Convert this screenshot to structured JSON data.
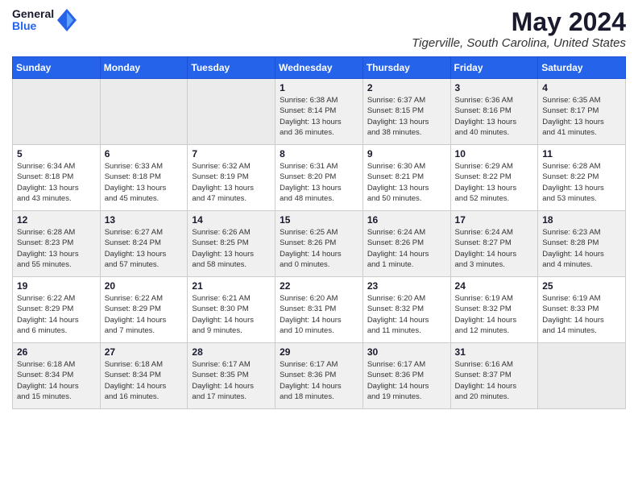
{
  "header": {
    "logo_general": "General",
    "logo_blue": "Blue",
    "month_title": "May 2024",
    "location": "Tigerville, South Carolina, United States"
  },
  "days_of_week": [
    "Sunday",
    "Monday",
    "Tuesday",
    "Wednesday",
    "Thursday",
    "Friday",
    "Saturday"
  ],
  "weeks": [
    [
      {
        "day": "",
        "info": ""
      },
      {
        "day": "",
        "info": ""
      },
      {
        "day": "",
        "info": ""
      },
      {
        "day": "1",
        "info": "Sunrise: 6:38 AM\nSunset: 8:14 PM\nDaylight: 13 hours\nand 36 minutes."
      },
      {
        "day": "2",
        "info": "Sunrise: 6:37 AM\nSunset: 8:15 PM\nDaylight: 13 hours\nand 38 minutes."
      },
      {
        "day": "3",
        "info": "Sunrise: 6:36 AM\nSunset: 8:16 PM\nDaylight: 13 hours\nand 40 minutes."
      },
      {
        "day": "4",
        "info": "Sunrise: 6:35 AM\nSunset: 8:17 PM\nDaylight: 13 hours\nand 41 minutes."
      }
    ],
    [
      {
        "day": "5",
        "info": "Sunrise: 6:34 AM\nSunset: 8:18 PM\nDaylight: 13 hours\nand 43 minutes."
      },
      {
        "day": "6",
        "info": "Sunrise: 6:33 AM\nSunset: 8:18 PM\nDaylight: 13 hours\nand 45 minutes."
      },
      {
        "day": "7",
        "info": "Sunrise: 6:32 AM\nSunset: 8:19 PM\nDaylight: 13 hours\nand 47 minutes."
      },
      {
        "day": "8",
        "info": "Sunrise: 6:31 AM\nSunset: 8:20 PM\nDaylight: 13 hours\nand 48 minutes."
      },
      {
        "day": "9",
        "info": "Sunrise: 6:30 AM\nSunset: 8:21 PM\nDaylight: 13 hours\nand 50 minutes."
      },
      {
        "day": "10",
        "info": "Sunrise: 6:29 AM\nSunset: 8:22 PM\nDaylight: 13 hours\nand 52 minutes."
      },
      {
        "day": "11",
        "info": "Sunrise: 6:28 AM\nSunset: 8:22 PM\nDaylight: 13 hours\nand 53 minutes."
      }
    ],
    [
      {
        "day": "12",
        "info": "Sunrise: 6:28 AM\nSunset: 8:23 PM\nDaylight: 13 hours\nand 55 minutes."
      },
      {
        "day": "13",
        "info": "Sunrise: 6:27 AM\nSunset: 8:24 PM\nDaylight: 13 hours\nand 57 minutes."
      },
      {
        "day": "14",
        "info": "Sunrise: 6:26 AM\nSunset: 8:25 PM\nDaylight: 13 hours\nand 58 minutes."
      },
      {
        "day": "15",
        "info": "Sunrise: 6:25 AM\nSunset: 8:26 PM\nDaylight: 14 hours\nand 0 minutes."
      },
      {
        "day": "16",
        "info": "Sunrise: 6:24 AM\nSunset: 8:26 PM\nDaylight: 14 hours\nand 1 minute."
      },
      {
        "day": "17",
        "info": "Sunrise: 6:24 AM\nSunset: 8:27 PM\nDaylight: 14 hours\nand 3 minutes."
      },
      {
        "day": "18",
        "info": "Sunrise: 6:23 AM\nSunset: 8:28 PM\nDaylight: 14 hours\nand 4 minutes."
      }
    ],
    [
      {
        "day": "19",
        "info": "Sunrise: 6:22 AM\nSunset: 8:29 PM\nDaylight: 14 hours\nand 6 minutes."
      },
      {
        "day": "20",
        "info": "Sunrise: 6:22 AM\nSunset: 8:29 PM\nDaylight: 14 hours\nand 7 minutes."
      },
      {
        "day": "21",
        "info": "Sunrise: 6:21 AM\nSunset: 8:30 PM\nDaylight: 14 hours\nand 9 minutes."
      },
      {
        "day": "22",
        "info": "Sunrise: 6:20 AM\nSunset: 8:31 PM\nDaylight: 14 hours\nand 10 minutes."
      },
      {
        "day": "23",
        "info": "Sunrise: 6:20 AM\nSunset: 8:32 PM\nDaylight: 14 hours\nand 11 minutes."
      },
      {
        "day": "24",
        "info": "Sunrise: 6:19 AM\nSunset: 8:32 PM\nDaylight: 14 hours\nand 12 minutes."
      },
      {
        "day": "25",
        "info": "Sunrise: 6:19 AM\nSunset: 8:33 PM\nDaylight: 14 hours\nand 14 minutes."
      }
    ],
    [
      {
        "day": "26",
        "info": "Sunrise: 6:18 AM\nSunset: 8:34 PM\nDaylight: 14 hours\nand 15 minutes."
      },
      {
        "day": "27",
        "info": "Sunrise: 6:18 AM\nSunset: 8:34 PM\nDaylight: 14 hours\nand 16 minutes."
      },
      {
        "day": "28",
        "info": "Sunrise: 6:17 AM\nSunset: 8:35 PM\nDaylight: 14 hours\nand 17 minutes."
      },
      {
        "day": "29",
        "info": "Sunrise: 6:17 AM\nSunset: 8:36 PM\nDaylight: 14 hours\nand 18 minutes."
      },
      {
        "day": "30",
        "info": "Sunrise: 6:17 AM\nSunset: 8:36 PM\nDaylight: 14 hours\nand 19 minutes."
      },
      {
        "day": "31",
        "info": "Sunrise: 6:16 AM\nSunset: 8:37 PM\nDaylight: 14 hours\nand 20 minutes."
      },
      {
        "day": "",
        "info": ""
      }
    ]
  ]
}
